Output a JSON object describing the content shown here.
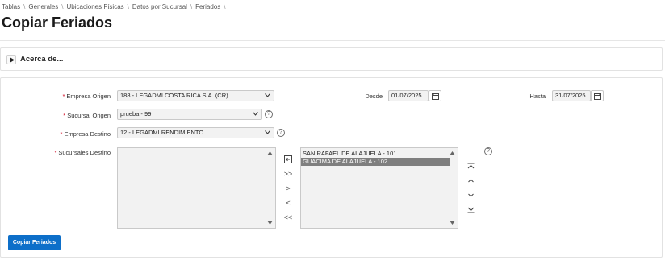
{
  "breadcrumb": [
    "Tablas",
    "Generales",
    "Ubicaciones Físicas",
    "Datos por Sucursal",
    "Feriados"
  ],
  "breadcrumb_separator": "\\",
  "page_title": "Copiar Feriados",
  "acerca": {
    "label": "Acerca de..."
  },
  "form": {
    "required_marker": "*",
    "empresa_origen": {
      "label": "Empresa Origen",
      "value": "188 - LEGADMI COSTA RICA S.A. (CR)"
    },
    "sucursal_origen": {
      "label": "Sucursal Origen",
      "value": "prueba - 99",
      "help": "?"
    },
    "empresa_destino": {
      "label": "Empresa Destino",
      "value": "12 - LEGADMI RENDIMIENTO",
      "help": "?"
    },
    "sucursales_destino": {
      "label": "Sucursales Destino",
      "available": [],
      "selected": [
        "SAN RAFAEL DE ALAJUELA - 101",
        "GUACIMA DE ALAJUELA - 102"
      ],
      "selected_highlight": "GUACIMA DE ALAJUELA - 102",
      "help": "?",
      "buttons": {
        "reset": "reset-icon",
        "move_all": ">>",
        "move": ">",
        "remove": "<",
        "remove_all": "<<",
        "top": "move-top-icon",
        "up": "move-up-icon",
        "down": "move-down-icon",
        "bottom": "move-bottom-icon"
      }
    },
    "desde": {
      "label": "Desde",
      "value": "01/07/2025"
    },
    "hasta": {
      "label": "Hasta",
      "value": "31/07/2025"
    }
  },
  "actions": {
    "copy_label": "Copiar Feriados"
  },
  "colors": {
    "primary": "#0d6fc9",
    "required": "#d0021b",
    "selected_row": "#7f7f7f"
  }
}
